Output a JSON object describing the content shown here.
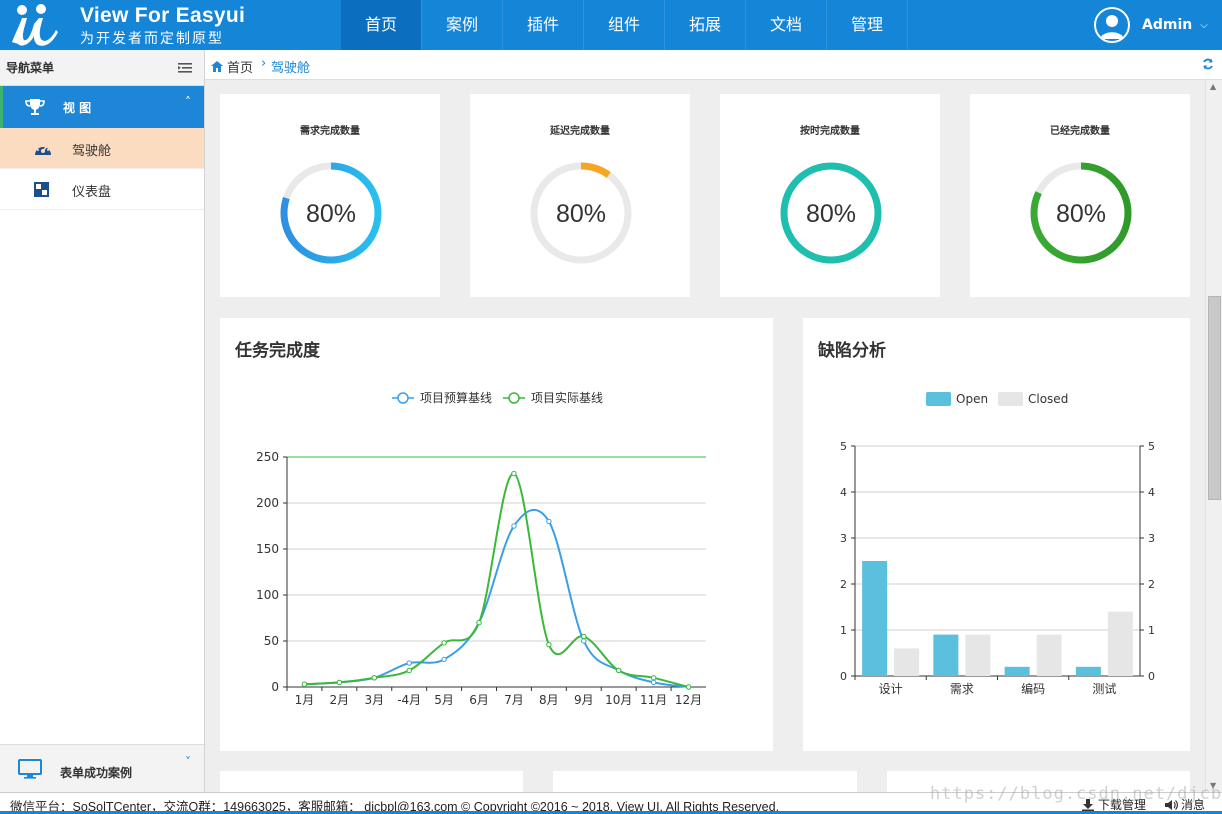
{
  "header": {
    "brand_title": "View For Easyui",
    "brand_subtitle": "为开发者而定制原型",
    "nav": [
      "首页",
      "案例",
      "插件",
      "组件",
      "拓展",
      "文档",
      "管理"
    ],
    "active_nav": 0,
    "user_name": "Admin",
    "colors": {
      "bar": "#1585d8",
      "active": "#0b6ebf"
    }
  },
  "sidebar": {
    "title": "导航菜单",
    "group_label": "视 图",
    "items": [
      "驾驶舱",
      "仪表盘"
    ],
    "bottom_label": "表单成功案例"
  },
  "breadcrumb": {
    "home": "首页",
    "current": "驾驶舱"
  },
  "stats": [
    {
      "title": "需求完成数量",
      "value": "80%",
      "percent": 0.8,
      "color": "#2e8fe3",
      "color2": "#28c0ee"
    },
    {
      "title": "延迟完成数量",
      "value": "80%",
      "percent": 0.1,
      "color": "#f5a623",
      "color2": "#f5a623"
    },
    {
      "title": "按时完成数量",
      "value": "80%",
      "percent": 1.0,
      "color": "#1fbfb0",
      "color2": "#1fbfb0"
    },
    {
      "title": "已经完成数量",
      "value": "80%",
      "percent": 0.82,
      "color": "#3aaa35",
      "color2": "#2f9a2a"
    }
  ],
  "panels": {
    "task_title": "任务完成度",
    "defect_title": "缺陷分析"
  },
  "chart_data": [
    {
      "type": "line",
      "legend": [
        "项目预算基线",
        "项目实际基线"
      ],
      "categories": [
        "1月",
        "2月",
        "3月",
        "-4月",
        "5月",
        "6月",
        "7月",
        "8月",
        "9月",
        "10月",
        "11月",
        "12月"
      ],
      "series": [
        {
          "name": "项目预算基线",
          "color": "#3a9ee8",
          "values": [
            3,
            5,
            10,
            26,
            30,
            70,
            175,
            180,
            50,
            18,
            5,
            0
          ]
        },
        {
          "name": "项目实际基线",
          "color": "#3bb83b",
          "values": [
            3,
            5,
            10,
            18,
            48,
            70,
            232,
            46,
            55,
            18,
            10,
            0
          ]
        }
      ],
      "ylim": [
        0,
        250
      ],
      "yticks": [
        0,
        50,
        100,
        150,
        200,
        250
      ],
      "grid": true
    },
    {
      "type": "bar",
      "legend": [
        "Open",
        "Closed"
      ],
      "categories": [
        "设计",
        "需求",
        "编码",
        "测试"
      ],
      "series": [
        {
          "name": "Open",
          "color": "#5bbfde",
          "values": [
            2.5,
            0.9,
            0.2,
            0.2
          ]
        },
        {
          "name": "Closed",
          "color": "#e6e6e6",
          "values": [
            0.6,
            0.9,
            0.9,
            1.4
          ]
        }
      ],
      "ylim": [
        0,
        5
      ],
      "yticks": [
        0,
        1,
        2,
        3,
        4,
        5
      ],
      "grid": true
    }
  ],
  "footer": {
    "text": "微信平台：SoSolTCenter，交流Q群：149663025，客服邮箱：  djcbpl@163.com  © Copyright ©2016 ~ 2018. View UI. All Rights Reserved.",
    "download": "下载管理",
    "messages": "消息",
    "watermark": "https://blog.csdn.net/djcbpl"
  }
}
